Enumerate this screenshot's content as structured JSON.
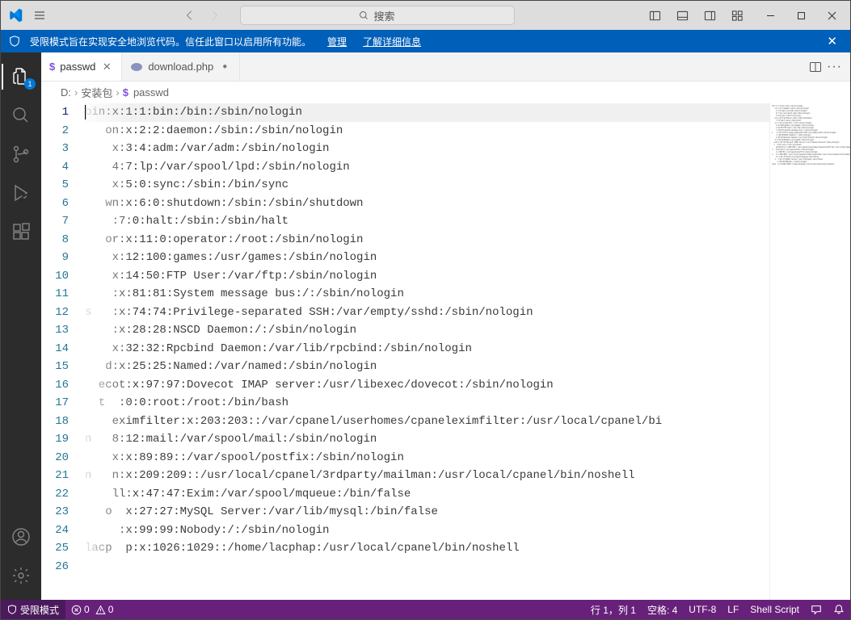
{
  "search": {
    "placeholder": "搜索"
  },
  "banner": {
    "text": "受限模式旨在实现安全地浏览代码。信任此窗口以启用所有功能。",
    "manage": "管理",
    "learn_more": "了解详细信息"
  },
  "activitybar": {
    "explorer_badge": "1"
  },
  "tabs": [
    {
      "icon": "$",
      "label": "passwd",
      "active": true,
      "dirty": false
    },
    {
      "icon": "php",
      "label": "download.php",
      "active": false,
      "dirty": true
    }
  ],
  "breadcrumbs": {
    "parts": [
      "D:",
      "安装包"
    ],
    "file": "passwd"
  },
  "code": [
    "bin:x:1:1:bin:/bin:/sbin/nologin",
    "   on:x:2:2:daemon:/sbin:/sbin/nologin",
    "    x:3:4:adm:/var/adm:/sbin/nologin",
    "    4:7:lp:/var/spool/lpd:/sbin/nologin",
    "    x:5:0:sync:/sbin:/bin/sync",
    "   wn:x:6:0:shutdown:/sbin:/sbin/shutdown",
    "    :7:0:halt:/sbin:/sbin/halt",
    "   or:x:11:0:operator:/root:/sbin/nologin",
    "    x:12:100:games:/usr/games:/sbin/nologin",
    "    x:14:50:FTP User:/var/ftp:/sbin/nologin",
    "    :x:81:81:System message bus:/:/sbin/nologin",
    "s   :x:74:74:Privilege-separated SSH:/var/empty/sshd:/sbin/nologin",
    "    :x:28:28:NSCD Daemon:/:/sbin/nologin",
    "    x:32:32:Rpcbind Daemon:/var/lib/rpcbind:/sbin/nologin",
    "   d:x:25:25:Named:/var/named:/sbin/nologin",
    "  ecot:x:97:97:Dovecot IMAP server:/usr/libexec/dovecot:/sbin/nologin",
    "  t  :0:0:root:/root:/bin/bash",
    "    eximfilter:x:203:203::/var/cpanel/userhomes/cpaneleximfilter:/usr/local/cpanel/bi",
    "n   8:12:mail:/var/spool/mail:/sbin/nologin",
    "    x:x:89:89::/var/spool/postfix:/sbin/nologin",
    "n   n:x:209:209::/usr/local/cpanel/3rdparty/mailman:/usr/local/cpanel/bin/noshell",
    "    ll:x:47:47:Exim:/var/spool/mqueue:/bin/false",
    "   o  x:27:27:MySQL Server:/var/lib/mysql:/bin/false",
    "     :x:99:99:Nobody:/:/sbin/nologin",
    "lacp  p:x:1026:1029::/home/lacphap:/usr/local/cpanel/bin/noshell",
    ""
  ],
  "status": {
    "restricted": "受限模式",
    "errors": "0",
    "warnings": "0",
    "line_col": "行 1，列 1",
    "spaces": "空格: 4",
    "encoding": "UTF-8",
    "eol": "LF",
    "language": "Shell Script"
  }
}
